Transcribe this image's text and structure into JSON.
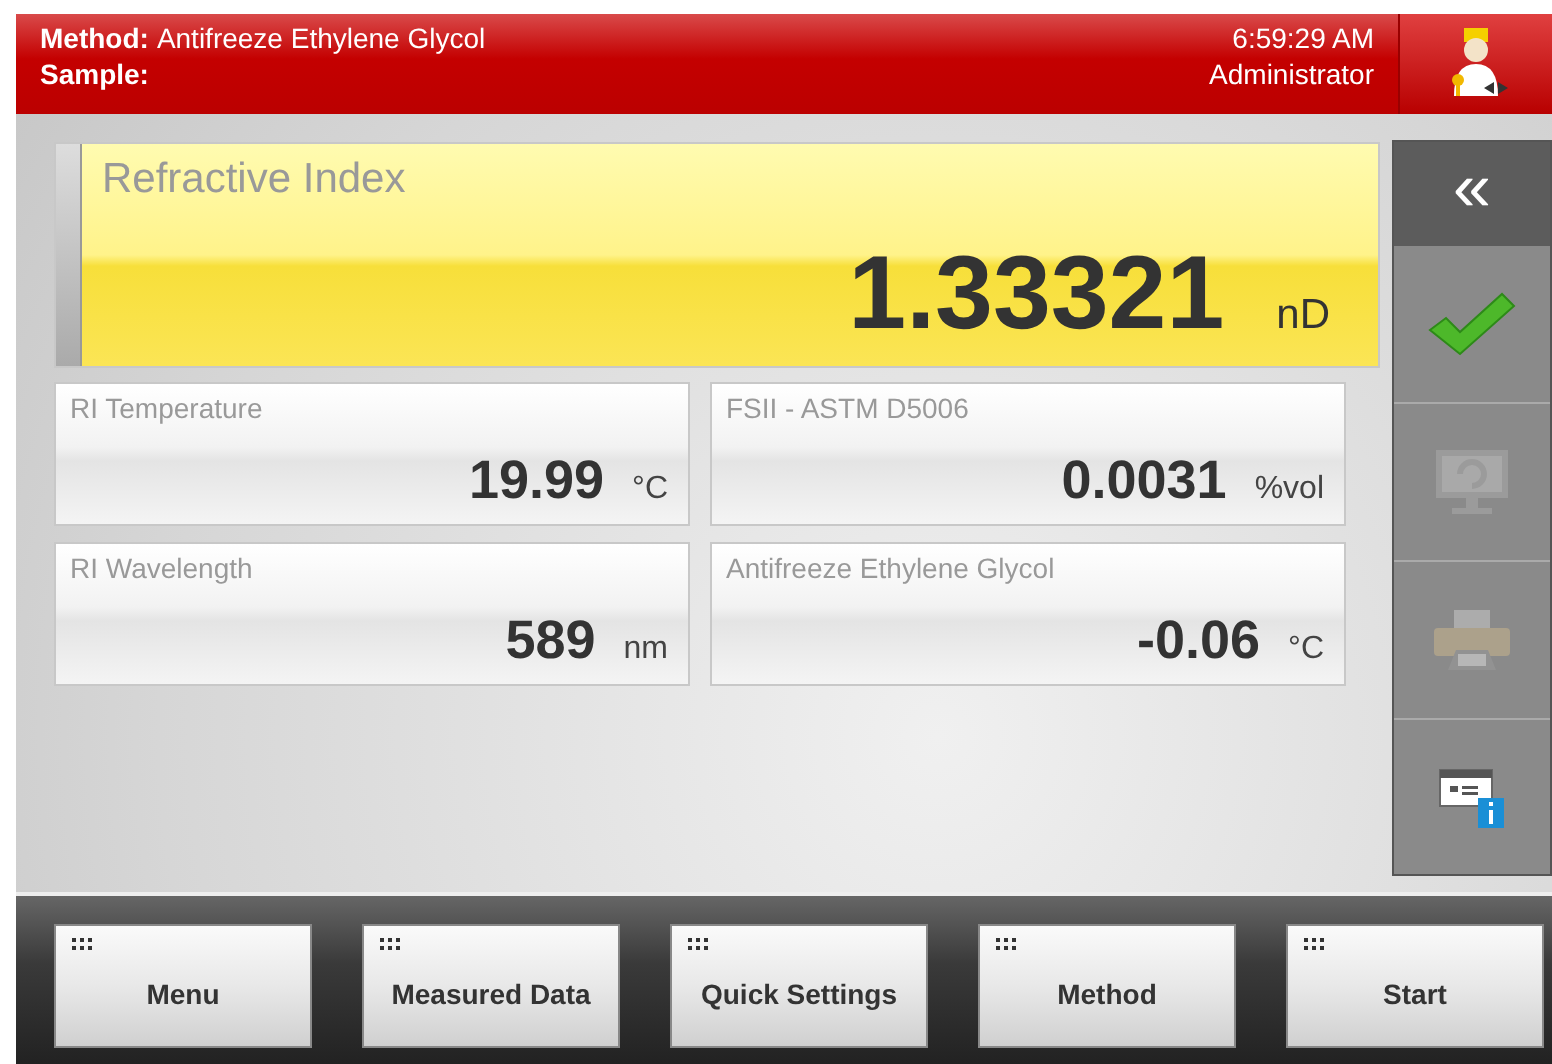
{
  "header": {
    "method_label": "Method:",
    "method": "Antifreeze Ethylene Glycol",
    "sample_label": "Sample:",
    "time": "6:59:29 AM",
    "user": "Administrator"
  },
  "main_result": {
    "label": "Refractive Index",
    "value": "1.33321",
    "unit": "nD"
  },
  "results": [
    {
      "label": "RI Temperature",
      "value": "19.99",
      "unit": "°C"
    },
    {
      "label": "FSII - ASTM D5006",
      "value": "0.0031",
      "unit": "%vol"
    },
    {
      "label": "RI Wavelength",
      "value": "589",
      "unit": "nm"
    },
    {
      "label": "Antifreeze Ethylene Glycol",
      "value": "-0.06",
      "unit": "°C"
    }
  ],
  "sidebar": [
    {
      "kind": "collapse",
      "label": "«",
      "disabled": false
    },
    {
      "kind": "check",
      "disabled": false
    },
    {
      "kind": "monitor",
      "disabled": true
    },
    {
      "kind": "printer",
      "disabled": true
    },
    {
      "kind": "info",
      "disabled": false
    }
  ],
  "buttons": [
    "Menu",
    "Measured Data",
    "Quick Settings",
    "Method",
    "Start"
  ]
}
